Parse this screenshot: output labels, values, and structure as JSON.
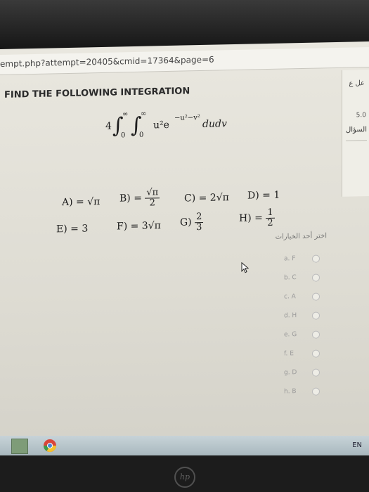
{
  "browser": {
    "url": "empt.php?attempt=20405&cmid=17364&page=6"
  },
  "question": {
    "title": "FIND THE FOLLOWING INTEGRATION",
    "coef": "4",
    "lower1": "0",
    "upper1": "∞",
    "lower2": "0",
    "upper2": "∞",
    "integrand": "u²e",
    "exponent": "−u²−v²",
    "differential": "dudv"
  },
  "options": {
    "A": "A) = √π",
    "B_label": "B) =",
    "B_num": "√π",
    "B_den": "2",
    "C": "C) = 2√π",
    "D": "D) = 1",
    "E": "E) = 3",
    "F": "F) = 3√π",
    "G_label": "G)",
    "G_num": "2",
    "G_den": "3",
    "H_label": "H) =",
    "H_num": "1",
    "H_den": "2"
  },
  "sidebar": {
    "status": "عل ع",
    "mark": "5.0",
    "question_flag": "السؤال"
  },
  "choices_header": "اختر أحد الخيارات",
  "choices": [
    "a. F",
    "b. C",
    "c. A",
    "d. H",
    "e. G",
    "f. E",
    "g. D",
    "h. B"
  ],
  "taskbar": {
    "lang": "EN"
  },
  "bezel": {
    "brand": "hp"
  }
}
